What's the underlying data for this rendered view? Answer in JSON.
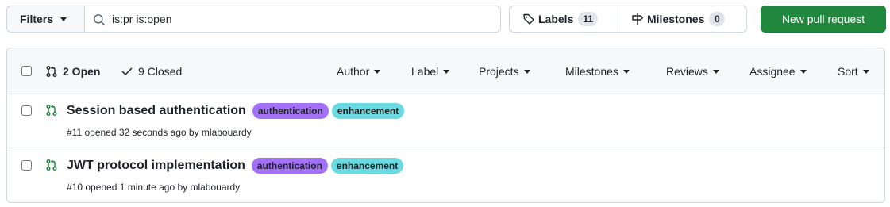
{
  "toolbar": {
    "filters_label": "Filters",
    "search_value": "is:pr is:open",
    "labels_label": "Labels",
    "labels_count": "11",
    "milestones_label": "Milestones",
    "milestones_count": "0",
    "new_pr_label": "New pull request"
  },
  "list_header": {
    "open_label": "2 Open",
    "closed_label": "9 Closed",
    "filters": [
      "Author",
      "Label",
      "Projects",
      "Milestones",
      "Reviews",
      "Assignee",
      "Sort"
    ]
  },
  "pull_requests": [
    {
      "title": "Session based authentication",
      "labels": [
        "authentication",
        "enhancement"
      ],
      "meta": "#11 opened 32 seconds ago by mlabouardy"
    },
    {
      "title": "JWT protocol implementation",
      "labels": [
        "authentication",
        "enhancement"
      ],
      "meta": "#10 opened 1 minute ago by mlabouardy"
    }
  ],
  "colors": {
    "primary_green": "#1f883d",
    "open_icon_green": "#1a7f37",
    "label_authentication": "#a371f7",
    "label_enhancement": "#69dbe1"
  },
  "icons": {
    "search": "search-icon",
    "labels": "tag-icon",
    "milestones": "milestone-icon",
    "open": "pull-request-icon",
    "closed": "check-icon"
  }
}
